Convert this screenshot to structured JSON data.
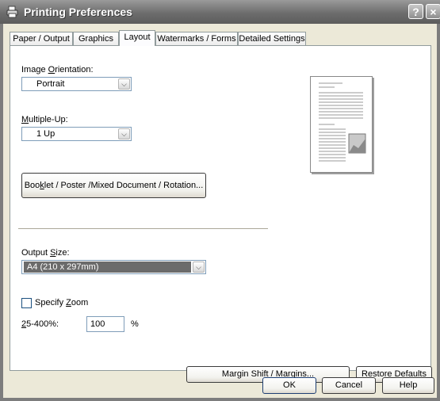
{
  "window": {
    "title": "Printing Preferences",
    "help_glyph": "?",
    "close_glyph": "×",
    "icon": "printer-icon"
  },
  "tabs": [
    {
      "label": "Paper / Output",
      "active": false
    },
    {
      "label": "Graphics",
      "active": false
    },
    {
      "label": "Layout",
      "active": true
    },
    {
      "label": "Watermarks / Forms",
      "active": false
    },
    {
      "label": "Detailed Settings",
      "active": false
    }
  ],
  "layout": {
    "orientation": {
      "label_pre": "Image ",
      "label_key": "O",
      "label_post": "rientation:",
      "value": "Portrait"
    },
    "multiple_up": {
      "label_key": "M",
      "label_post": "ultiple-Up:",
      "value": "1 Up"
    },
    "booklet_button": {
      "label_pre": "Boo",
      "label_key": "k",
      "label_post": "let / Poster /Mixed Document / Rotation..."
    },
    "output_size": {
      "label_pre": "Output ",
      "label_key": "S",
      "label_post": "ize:",
      "value": "A4 (210 x 297mm)"
    },
    "specify_zoom": {
      "label_pre": "Specify ",
      "label_key": "Z",
      "label_post": "oom",
      "checked": false
    },
    "zoom": {
      "range_key": "2",
      "range_post": "5-400%:",
      "value": "100",
      "unit": "%"
    },
    "margin_button": {
      "label_pre": "Mar",
      "label_key": "g",
      "label_post": "in Shift / Margins..."
    },
    "restore_button": {
      "label_pre": "Restore ",
      "label_key": "D",
      "label_post": "efaults"
    }
  },
  "footer": {
    "ok": "OK",
    "cancel": "Cancel",
    "help": "Help"
  },
  "arrow_glyph": "⌵"
}
